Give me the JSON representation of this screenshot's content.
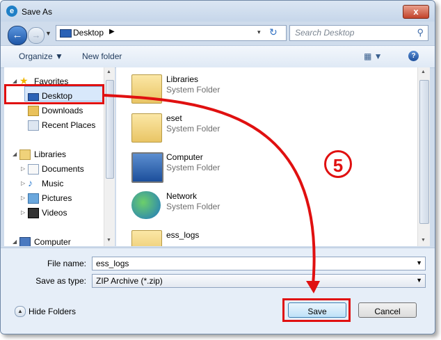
{
  "window": {
    "title": "Save As",
    "app_icon": "e",
    "close_label": "x"
  },
  "address": {
    "location": "Desktop",
    "chevron": "▶",
    "dropdown": "▾",
    "refresh": "↻"
  },
  "search": {
    "placeholder": "Search Desktop",
    "icon": "search-icon"
  },
  "toolbar": {
    "organize": "Organize ▼",
    "new_folder": "New folder",
    "view": "▦ ▼",
    "help": "?"
  },
  "nav": {
    "favorites": "Favorites",
    "desktop": "Desktop",
    "downloads": "Downloads",
    "recent": "Recent Places",
    "libraries": "Libraries",
    "documents": "Documents",
    "music": "Music",
    "pictures": "Pictures",
    "videos": "Videos",
    "computer": "Computer"
  },
  "files": [
    {
      "name": "Libraries",
      "type": "System Folder",
      "icon": "libraries-icon"
    },
    {
      "name": "eset",
      "type": "System Folder",
      "icon": "user-folder-icon"
    },
    {
      "name": "Computer",
      "type": "System Folder",
      "icon": "computer-icon"
    },
    {
      "name": "Network",
      "type": "System Folder",
      "icon": "network-icon"
    },
    {
      "name": "ess_logs",
      "type": "",
      "icon": "zip-folder-icon"
    }
  ],
  "form": {
    "file_name_label": "File name:",
    "file_name_value": "ess_logs",
    "save_type_label": "Save as type:",
    "save_type_value": "ZIP Archive (*.zip)"
  },
  "buttons": {
    "hide_folders": "Hide Folders",
    "save": "Save",
    "cancel": "Cancel"
  },
  "annotation": {
    "step": "5",
    "color": "#e01010"
  }
}
